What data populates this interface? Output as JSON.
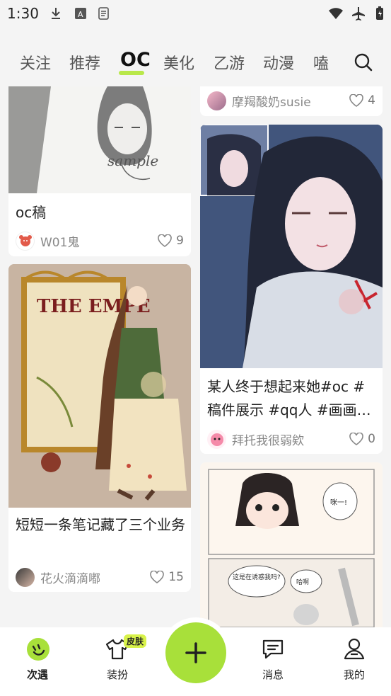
{
  "status": {
    "time": "1:30"
  },
  "tabs": [
    {
      "label": "关注"
    },
    {
      "label": "推荐"
    },
    {
      "label": "OC"
    },
    {
      "label": "美化"
    },
    {
      "label": "乙游"
    },
    {
      "label": "动漫"
    },
    {
      "label": "嗑"
    }
  ],
  "feed": {
    "c1": {
      "title": "oc稿",
      "author": "W01鬼",
      "likes": "9"
    },
    "c2": {
      "author": "摩羯酸奶susie",
      "likes": "4"
    },
    "c3": {
      "title": "短短一条笔记藏了三个业务",
      "author": "花火滴滴嘟",
      "likes": "15",
      "image_text": "THE EMPE"
    },
    "c4": {
      "title": "某人终于想起来她#oc #稿件展示 #qq人 #画画…",
      "author": "拜托我很弱欸",
      "likes": "0"
    },
    "c5": {
      "speech": [
        "咪一!",
        "这是在诱惑我吗?",
        "哈啊"
      ]
    }
  },
  "bottom_nav": {
    "items": [
      {
        "label": "次遇"
      },
      {
        "label": "装扮"
      },
      {
        "label": "消息"
      },
      {
        "label": "我的"
      }
    ],
    "badge": "皮肤"
  },
  "colors": {
    "accent": "#b9e84a",
    "plus": "#a8e03a"
  }
}
